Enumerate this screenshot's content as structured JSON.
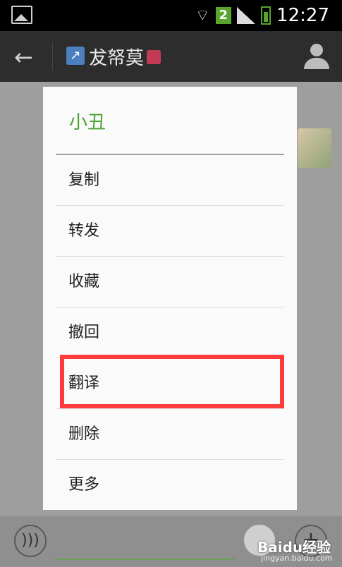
{
  "status_bar": {
    "notification_badge": "2",
    "time": "12:27"
  },
  "title_bar": {
    "chat_name": "犮帑莫"
  },
  "dialog": {
    "title": "小丑",
    "menu_items": [
      {
        "label": "复制"
      },
      {
        "label": "转发"
      },
      {
        "label": "收藏"
      },
      {
        "label": "撤回"
      },
      {
        "label": "翻译",
        "highlighted": true
      },
      {
        "label": "删除"
      },
      {
        "label": "更多"
      }
    ],
    "title_color": "#4ca233",
    "highlight_color": "#ff3b3b"
  },
  "watermark": {
    "brand": "Baidu经验",
    "site": "jingyan.baidu.com"
  }
}
